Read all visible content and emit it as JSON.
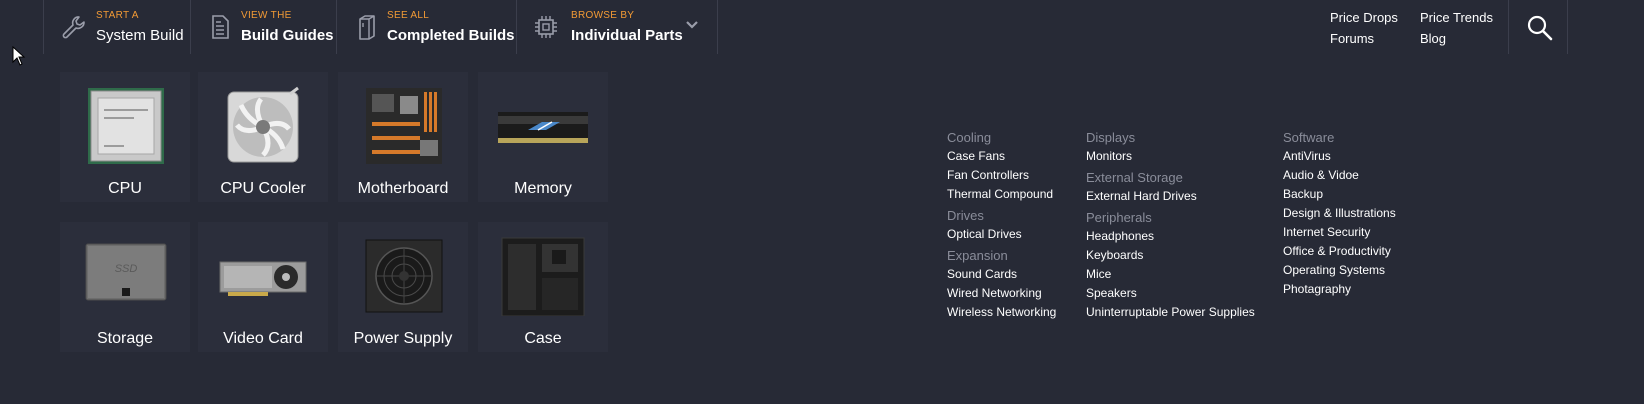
{
  "nav": {
    "items": [
      {
        "small": "START A",
        "big": "System Build"
      },
      {
        "small": "VIEW THE",
        "big": "Build Guides"
      },
      {
        "small": "SEE ALL",
        "big": "Completed Builds"
      },
      {
        "small": "BROWSE BY",
        "big": "Individual Parts"
      }
    ],
    "quick_links": [
      "Price Drops",
      "Price Trends",
      "Forums",
      "Blog"
    ]
  },
  "parts": [
    {
      "label": "CPU",
      "icon": "cpu-icon"
    },
    {
      "label": "CPU Cooler",
      "icon": "cpu-cooler-icon"
    },
    {
      "label": "Motherboard",
      "icon": "motherboard-icon"
    },
    {
      "label": "Memory",
      "icon": "memory-icon"
    },
    {
      "label": "Storage",
      "icon": "storage-icon"
    },
    {
      "label": "Video Card",
      "icon": "video-card-icon"
    },
    {
      "label": "Power Supply",
      "icon": "power-supply-icon"
    },
    {
      "label": "Case",
      "icon": "case-icon"
    }
  ],
  "ssd_text": "SSD",
  "categories": {
    "col1": [
      {
        "heading": "Cooling",
        "links": [
          "Case Fans",
          "Fan Controllers",
          "Thermal Compound"
        ]
      },
      {
        "heading": "Drives",
        "links": [
          "Optical Drives"
        ]
      },
      {
        "heading": "Expansion",
        "links": [
          "Sound Cards",
          "Wired Networking",
          "Wireless Networking"
        ]
      }
    ],
    "col2": [
      {
        "heading": "Displays",
        "links": [
          "Monitors"
        ]
      },
      {
        "heading": "External Storage",
        "links": [
          "External Hard Drives"
        ]
      },
      {
        "heading": "Peripherals",
        "links": [
          "Headphones",
          "Keyboards",
          "Mice",
          "Speakers",
          "Uninterruptable Power Supplies"
        ]
      }
    ],
    "col3": [
      {
        "heading": "Software",
        "links": [
          "AntiVirus",
          "Audio & Vidoe",
          "Backup",
          "Design & Illustrations",
          "Internet Security",
          "Office & Productivity",
          "Operating Systems",
          "Photagraphy"
        ]
      }
    ]
  },
  "colors": {
    "accent": "#f29a35",
    "background": "#272a36",
    "tile": "#2b2e3b",
    "muted": "#8a8d9a"
  }
}
